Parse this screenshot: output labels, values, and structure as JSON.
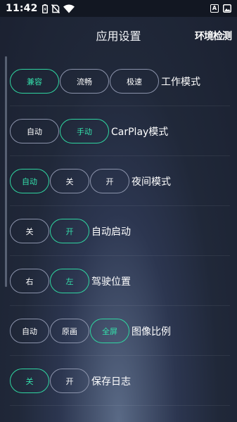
{
  "status_bar": {
    "time": "11:42",
    "right_icon_label": "A"
  },
  "header": {
    "title": "应用设置",
    "action": "环境检测"
  },
  "settings": [
    {
      "label": "工作模式",
      "options": [
        "兼容",
        "流畅",
        "极速"
      ],
      "selected": 0
    },
    {
      "label": "CarPlay模式",
      "options": [
        "自动",
        "手动"
      ],
      "selected": 1
    },
    {
      "label": "夜间模式",
      "options": [
        "自动",
        "关",
        "开"
      ],
      "selected": 0
    },
    {
      "label": "自动启动",
      "options": [
        "关",
        "开"
      ],
      "selected": 1
    },
    {
      "label": "驾驶位置",
      "options": [
        "右",
        "左"
      ],
      "selected": 1
    },
    {
      "label": "图像比例",
      "options": [
        "自动",
        "原画",
        "全屏"
      ],
      "selected": 2
    },
    {
      "label": "保存日志",
      "options": [
        "关",
        "开"
      ],
      "selected": 0
    }
  ],
  "colors": {
    "accent": "#2fd6a1",
    "border": "#8b93ab",
    "background": "#1b2131"
  }
}
